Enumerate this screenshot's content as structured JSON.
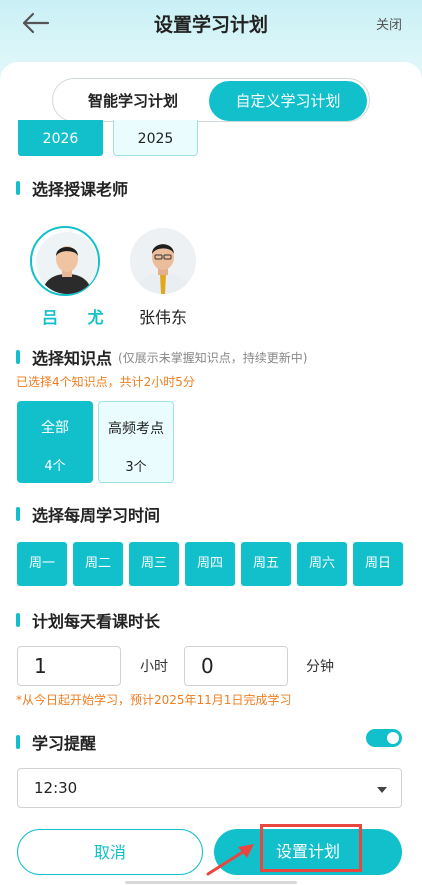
{
  "header": {
    "title": "设置学习计划",
    "close_label": "关闭"
  },
  "tabs": [
    {
      "label": "智能学习计划",
      "active": false
    },
    {
      "label": "自定义学习计划",
      "active": true
    }
  ],
  "years": [
    {
      "label": "2026",
      "selected": true
    },
    {
      "label": "2025",
      "selected": false
    }
  ],
  "teacher_section": {
    "title": "选择授课老师",
    "teachers": [
      {
        "name": "吕尤",
        "display": "吕 尤",
        "selected": true
      },
      {
        "name": "张伟东",
        "selected": false
      }
    ]
  },
  "knowledge_section": {
    "title": "选择知识点",
    "note": "(仅展示未掌握知识点，持续更新中)",
    "summary": "已选择4个知识点，共计2小时5分",
    "options": [
      {
        "label": "全部",
        "count": "4个",
        "selected": true
      },
      {
        "label": "高频考点",
        "count": "3个",
        "selected": false
      }
    ]
  },
  "weekday_section": {
    "title": "选择每周学习时间",
    "days": [
      "周一",
      "周二",
      "周三",
      "周四",
      "周五",
      "周六",
      "周日"
    ]
  },
  "duration_section": {
    "title": "计划每天看课时长",
    "hours_value": "1",
    "hours_unit": "小时",
    "minutes_value": "0",
    "minutes_unit": "分钟",
    "hint": "*从今日起开始学习，预计2025年11月1日完成学习"
  },
  "reminder_section": {
    "title": "学习提醒",
    "enabled": true,
    "time": "12:30"
  },
  "footer": {
    "cancel_label": "取消",
    "confirm_label": "设置计划"
  },
  "colors": {
    "accent": "#12c0cc",
    "warning": "#f07d1e",
    "annotation": "#e8473f"
  }
}
